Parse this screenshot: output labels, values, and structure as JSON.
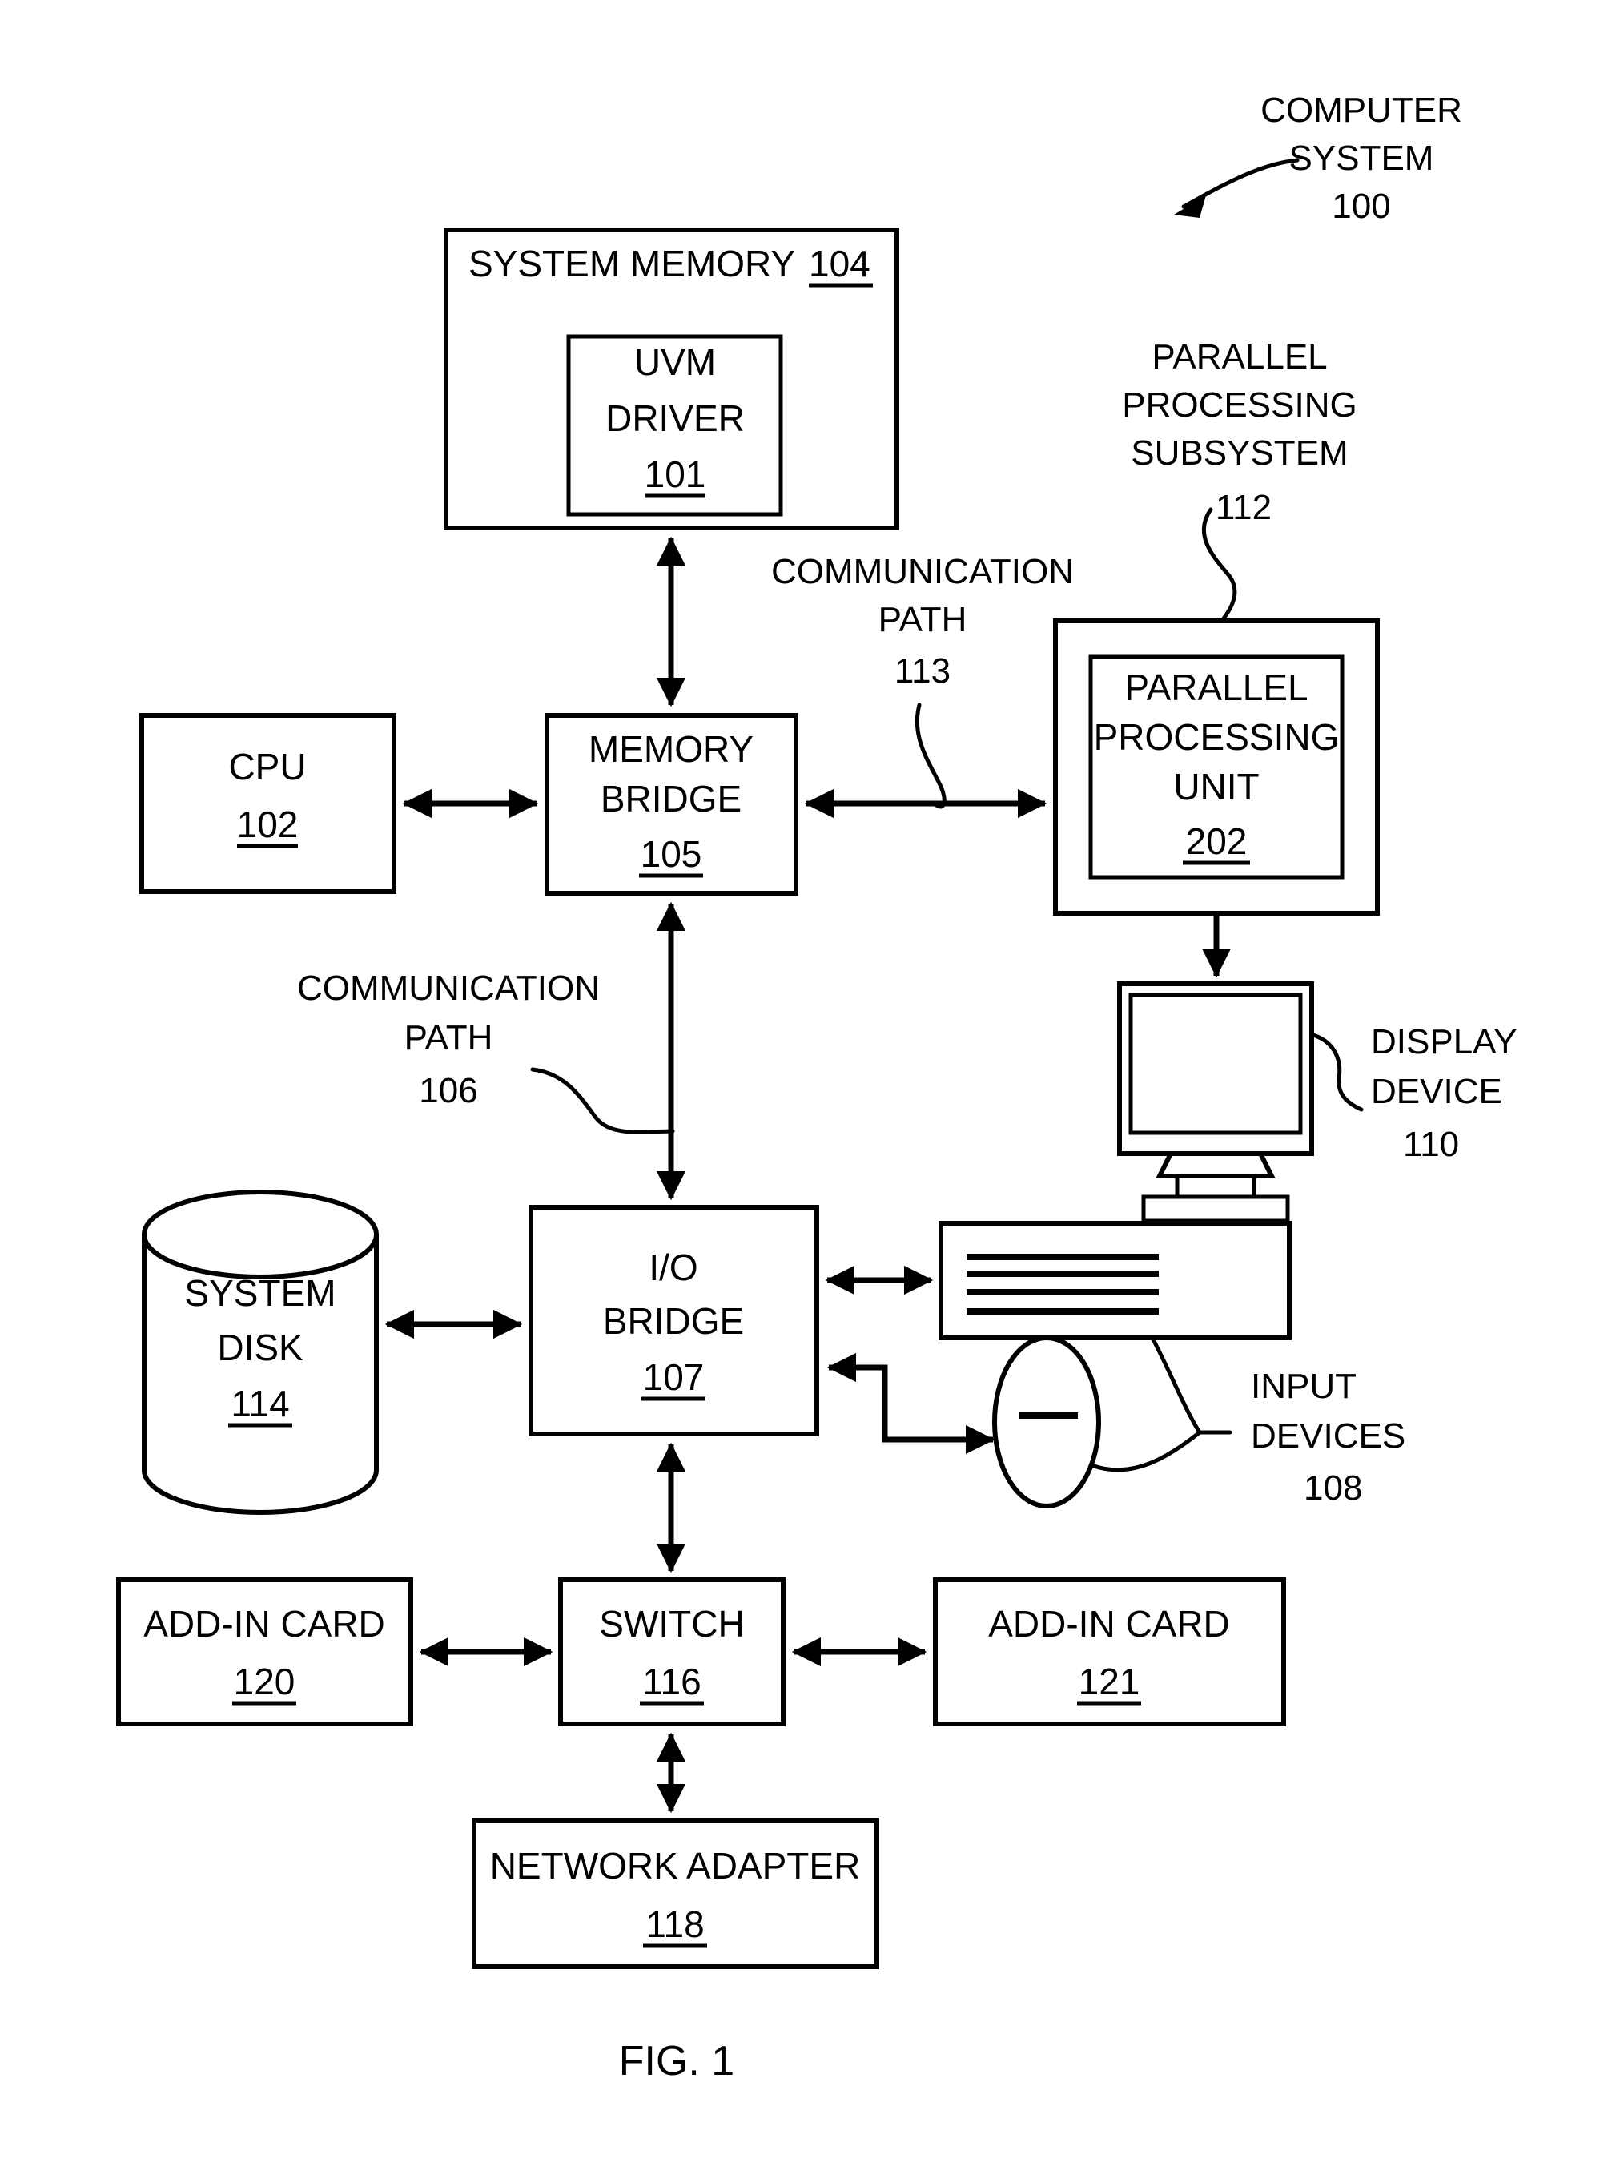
{
  "figure": {
    "caption": "FIG. 1",
    "title_label": {
      "line1": "COMPUTER",
      "line2": "SYSTEM",
      "number": "100"
    }
  },
  "blocks": {
    "system_memory": {
      "label": "SYSTEM MEMORY",
      "number": "104"
    },
    "uvm_driver": {
      "line1": "UVM",
      "line2": "DRIVER",
      "number": "101"
    },
    "cpu": {
      "label": "CPU",
      "number": "102"
    },
    "memory_bridge": {
      "line1": "MEMORY",
      "line2": "BRIDGE",
      "number": "105"
    },
    "parallel_processing_unit": {
      "line1": "PARALLEL",
      "line2": "PROCESSING",
      "line3": "UNIT",
      "number": "202"
    },
    "io_bridge": {
      "line1": "I/O",
      "line2": "BRIDGE",
      "number": "107"
    },
    "system_disk": {
      "line1": "SYSTEM",
      "line2": "DISK",
      "number": "114"
    },
    "switch": {
      "label": "SWITCH",
      "number": "116"
    },
    "add_in_card_left": {
      "label": "ADD-IN CARD",
      "number": "120"
    },
    "add_in_card_right": {
      "label": "ADD-IN CARD",
      "number": "121"
    },
    "network_adapter": {
      "label": "NETWORK ADAPTER",
      "number": "118"
    }
  },
  "callouts": {
    "parallel_processing_subsystem": {
      "line1": "PARALLEL",
      "line2": "PROCESSING",
      "line3": "SUBSYSTEM",
      "number": "112"
    },
    "communication_path_113": {
      "line1": "COMMUNICATION",
      "line2": "PATH",
      "number": "113"
    },
    "communication_path_106": {
      "line1": "COMMUNICATION",
      "line2": "PATH",
      "number": "106"
    },
    "display_device": {
      "line1": "DISPLAY",
      "line2": "DEVICE",
      "number": "110"
    },
    "input_devices": {
      "line1": "INPUT",
      "line2": "DEVICES",
      "number": "108"
    }
  },
  "icons": {
    "display_device": "monitor-icon",
    "keyboard": "keyboard-icon",
    "mouse": "mouse-icon",
    "system_disk": "cylinder-disk-icon"
  },
  "colors": {
    "ink": "#000000",
    "paper": "#ffffff"
  }
}
